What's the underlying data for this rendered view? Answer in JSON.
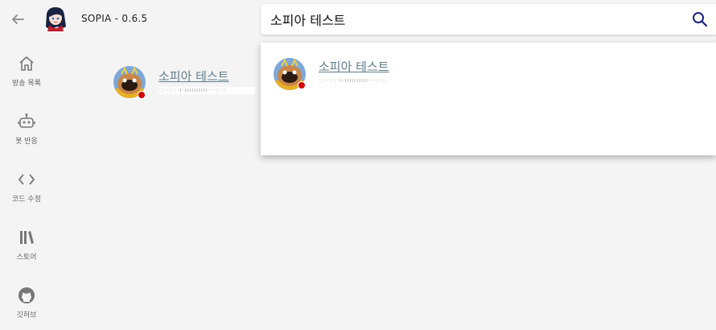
{
  "app": {
    "title": "SOPIA - 0.6.5",
    "back_icon": "arrow-left-icon",
    "logo": "sopia-logo"
  },
  "search": {
    "value": "소피아 테스트",
    "icon": "search-icon"
  },
  "sidebar": {
    "items": [
      {
        "label": "방송 목록",
        "icon": "home-icon"
      },
      {
        "label": "봇 반응",
        "icon": "robot-icon"
      },
      {
        "label": "코드 수정",
        "icon": "code-icon"
      },
      {
        "label": "스토어",
        "icon": "library-icon"
      },
      {
        "label": "깃허브",
        "icon": "github-icon"
      }
    ]
  },
  "main_result": {
    "name": "소피아 테스트",
    "sub": "·:··:·:·ı·ıııııııııı···:·:·"
  },
  "dropdown_result": {
    "name": "소피아 테스트",
    "sub": "·:··:·:·ı·ıııııııııı···:·:·"
  },
  "colors": {
    "background": "#f4f4f4",
    "name_link": "#607d8b",
    "live_dot": "#d40000",
    "search_icon": "#1a237e"
  }
}
